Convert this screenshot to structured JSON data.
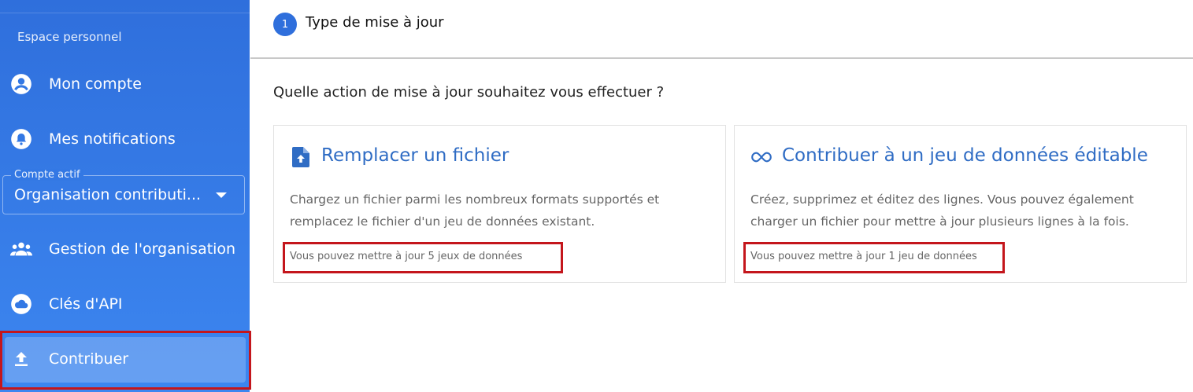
{
  "sidebar": {
    "section_label": "Espace personnel",
    "items": [
      {
        "label": "Mon compte",
        "icon": "account-circle-icon"
      },
      {
        "label": "Mes notifications",
        "icon": "bell-icon"
      },
      {
        "label": "Gestion de l'organisation",
        "icon": "group-icon"
      },
      {
        "label": "Clés d'API",
        "icon": "cloud-icon"
      },
      {
        "label": "Contribuer",
        "icon": "upload-icon"
      }
    ],
    "account_select": {
      "legend": "Compte actif",
      "value": "Organisation contributi..."
    },
    "accent_color": "#2f6fdc"
  },
  "stepper": {
    "step_number": "1",
    "step_title": "Type de mise à jour"
  },
  "main": {
    "question": "Quelle action de mise à jour souhaitez vous effectuer ?",
    "cards": [
      {
        "title": "Remplacer un fichier",
        "icon": "file-upload-icon",
        "description": "Chargez un fichier parmi les nombreux formats supportés et remplacez le fichier d'un jeu de données existant.",
        "quota": "Vous pouvez mettre à jour 5 jeux de données"
      },
      {
        "title": "Contribuer à un jeu de données éditable",
        "icon": "infinity-icon",
        "description": "Créez, supprimez et éditez des lignes. Vous pouvez également charger un fichier pour mettre à jour plusieurs lignes à la fois.",
        "quota": "Vous pouvez mettre à jour 1 jeu de données"
      }
    ],
    "title_color": "#2f6cc4",
    "highlight_color": "#c4161c"
  }
}
